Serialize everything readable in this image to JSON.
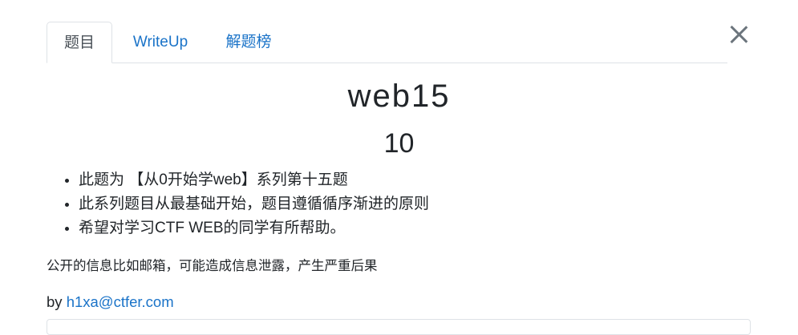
{
  "tabs": [
    {
      "label": "题目",
      "active": true
    },
    {
      "label": "WriteUp",
      "active": false
    },
    {
      "label": "解题榜",
      "active": false
    }
  ],
  "challenge": {
    "name": "web15",
    "score": "10",
    "description": [
      "此题为 【从0开始学web】系列第十五题",
      "此系列题目从最基础开始，题目遵循循序渐进的原则",
      "希望对学习CTF WEB的同学有所帮助。"
    ],
    "hint": "公开的信息比如邮箱，可能造成信息泄露，产生严重后果",
    "author_prefix": "by",
    "author_email": "h1xa@ctfer.com"
  },
  "icons": {
    "close": "close-icon"
  },
  "colors": {
    "accent": "#1a73c8",
    "text": "#212529",
    "border": "#dee2e6"
  }
}
